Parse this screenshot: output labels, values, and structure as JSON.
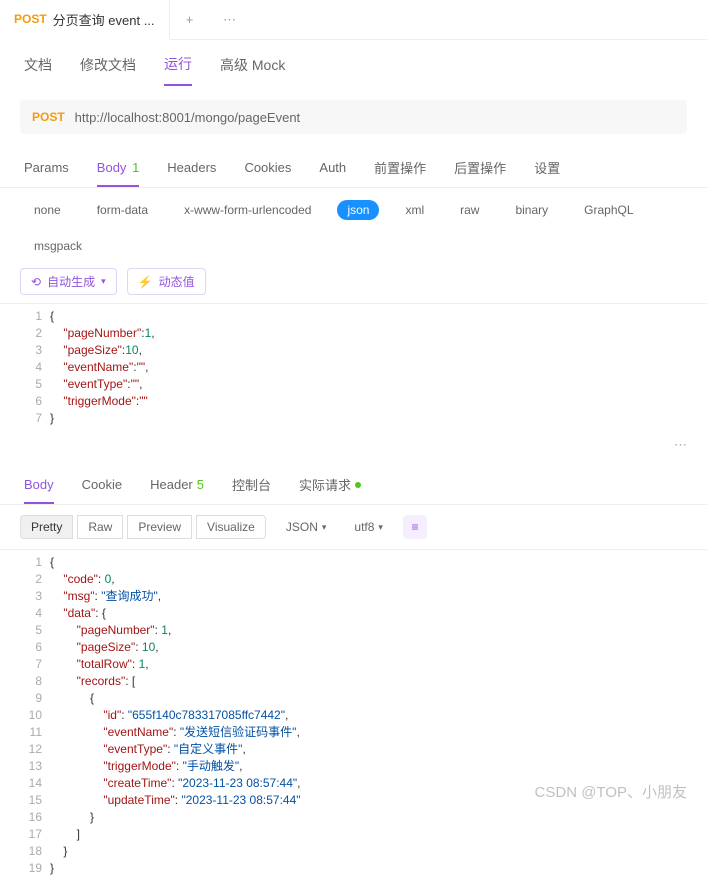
{
  "tab": {
    "method": "POST",
    "title": "分页查询 event ..."
  },
  "subtabs": {
    "doc": "文档",
    "edit": "修改文档",
    "run": "运行",
    "mock": "高级 Mock"
  },
  "request": {
    "method": "POST",
    "url": "http://localhost:8001/mongo/pageEvent"
  },
  "reqtabs": {
    "params": "Params",
    "body": "Body",
    "body_count": "1",
    "headers": "Headers",
    "cookies": "Cookies",
    "auth": "Auth",
    "pre": "前置操作",
    "post": "后置操作",
    "settings": "设置"
  },
  "bodytypes": {
    "none": "none",
    "form": "form-data",
    "urlenc": "x-www-form-urlencoded",
    "json": "json",
    "xml": "xml",
    "raw": "raw",
    "binary": "binary",
    "graphql": "GraphQL",
    "msgpack": "msgpack"
  },
  "toolbar": {
    "auto": "自动生成",
    "dynamic": "动态值"
  },
  "reqcode": {
    "lines": [
      "1",
      "2",
      "3",
      "4",
      "5",
      "6",
      "7"
    ],
    "open": "{",
    "kv": [
      {
        "k": "\"pageNumber\"",
        "v": "1",
        "t": "n",
        "c": ","
      },
      {
        "k": "\"pageSize\"",
        "v": "10",
        "t": "n",
        "c": ","
      },
      {
        "k": "\"eventName\"",
        "v": "\"\"",
        "t": "s",
        "c": ","
      },
      {
        "k": "\"eventType\"",
        "v": "\"\"",
        "t": "s",
        "c": ","
      },
      {
        "k": "\"triggerMode\"",
        "v": "\"\"",
        "t": "s",
        "c": ""
      }
    ],
    "close": "}"
  },
  "resptabs": {
    "body": "Body",
    "cookie": "Cookie",
    "header": "Header",
    "header_count": "5",
    "console": "控制台",
    "actual": "实际请求"
  },
  "fmt": {
    "pretty": "Pretty",
    "raw": "Raw",
    "preview": "Preview",
    "visualize": "Visualize",
    "json": "JSON",
    "utf8": "utf8"
  },
  "respcode": {
    "lines": [
      "1",
      "2",
      "3",
      "4",
      "5",
      "6",
      "7",
      "8",
      "9",
      "10",
      "11",
      "12",
      "13",
      "14",
      "15",
      "16",
      "17",
      "18",
      "19"
    ],
    "l1": "{",
    "l2k": "\"code\"",
    "l2v": "0",
    "l3k": "\"msg\"",
    "l3v": "\"查询成功\"",
    "l4k": "\"data\"",
    "l5k": "\"pageNumber\"",
    "l5v": "1",
    "l6k": "\"pageSize\"",
    "l6v": "10",
    "l7k": "\"totalRow\"",
    "l7v": "1",
    "l8k": "\"records\"",
    "l10k": "\"id\"",
    "l10v": "\"655f140c783317085ffc7442\"",
    "l11k": "\"eventName\"",
    "l11v": "\"发送短信验证码事件\"",
    "l12k": "\"eventType\"",
    "l12v": "\"自定义事件\"",
    "l13k": "\"triggerMode\"",
    "l13v": "\"手动触发\"",
    "l14k": "\"createTime\"",
    "l14v": "\"2023-11-23 08:57:44\"",
    "l15k": "\"updateTime\"",
    "l15v": "\"2023-11-23 08:57:44\"",
    "l19": "}"
  },
  "watermark": "CSDN @TOP、小朋友"
}
